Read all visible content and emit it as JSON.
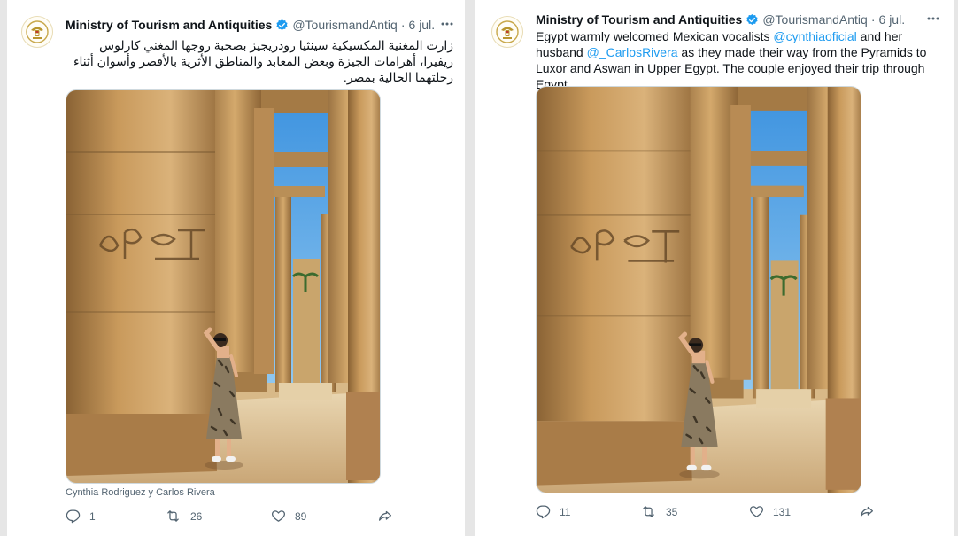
{
  "tweets": [
    {
      "author": {
        "name": "Ministry of Tourism and Antiquities",
        "handle": "@TourismandAntiq",
        "verified": true
      },
      "date": "6 jul.",
      "text": "زارت المغنية المكسيكية سينثيا رودريجيز بصحبة روجها المغني كارلوس ريفيرا، أهرامات الجيزة وبعض المعابد والمناطق الأثرية بالأقصر وأسوان أثناء رحلتهما الحالية بمصر.",
      "photo_caption": "Cynthia Rodriguez y Carlos Rivera",
      "actions": {
        "replies": "1",
        "retweets": "26",
        "likes": "89"
      }
    },
    {
      "author": {
        "name": "Ministry of Tourism and Antiquities",
        "handle": "@TourismandAntiq",
        "verified": true
      },
      "date": "6 jul.",
      "text_parts": {
        "p1": "Egypt warmly welcomed Mexican vocalists ",
        "m1": "@cynthiaoficial",
        "p2": " and her husband ",
        "m2": "@_CarlosRivera",
        "p3": " as they made their way from the Pyramids to Luxor and Aswan in Upper Egypt. The couple enjoyed their trip through Egypt."
      },
      "actions": {
        "replies": "11",
        "retweets": "35",
        "likes": "131"
      }
    }
  ],
  "icons": {
    "verified": "verified-badge-icon",
    "more": "more-dots-icon",
    "reply": "reply-bubble-icon",
    "retweet": "retweet-icon",
    "like": "heart-icon",
    "share": "share-arrow-icon",
    "avatar": "egypt-eagle-emblem"
  },
  "colors": {
    "link": "#1d9bf0",
    "verified": "#1d9bf0",
    "muted": "#536471",
    "text": "#0f1419"
  }
}
